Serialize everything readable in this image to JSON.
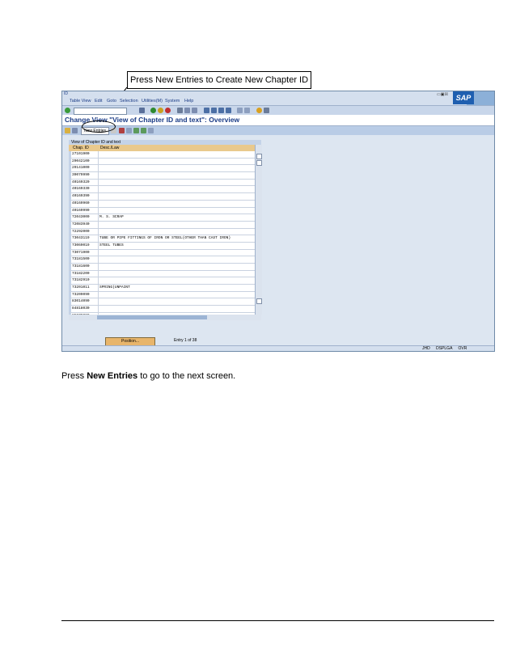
{
  "callout": {
    "text": "Press New Entries to Create New Chapter ID"
  },
  "window": {
    "title_icon": "ID"
  },
  "menu": {
    "items": [
      "Table View",
      "Edit",
      "Goto",
      "Selection",
      "Utilities(M)",
      "System",
      "Help"
    ]
  },
  "screen": {
    "title": "Change View \"View of Chapter ID and text\": Overview"
  },
  "app_toolbar": {
    "new_entries_label": "New Entries"
  },
  "table": {
    "caption": "View of Chapter ID and text",
    "columns": [
      "Chap. ID",
      "Desc./Law"
    ],
    "rows": [
      {
        "id": "27101900",
        "desc": ""
      },
      {
        "id": "29042100",
        "desc": ""
      },
      {
        "id": "29141000",
        "desc": ""
      },
      {
        "id": "39079990",
        "desc": ""
      },
      {
        "id": "40169320",
        "desc": ""
      },
      {
        "id": "40169330",
        "desc": ""
      },
      {
        "id": "40169390",
        "desc": ""
      },
      {
        "id": "40169960",
        "desc": ""
      },
      {
        "id": "40169990",
        "desc": ""
      },
      {
        "id": "72043000",
        "desc": "M. S. SCRAP"
      },
      {
        "id": "72083940",
        "desc": ""
      },
      {
        "id": "72292000",
        "desc": ""
      },
      {
        "id": "73043119",
        "desc": "TUBE OR PIPE FITTINGS OF IRON OR STEEL(OTHER THAN CAST IRON)"
      },
      {
        "id": "73069019",
        "desc": "STEEL TUBES"
      },
      {
        "id": "73071900",
        "desc": ""
      },
      {
        "id": "73181500",
        "desc": ""
      },
      {
        "id": "73181600",
        "desc": ""
      },
      {
        "id": "73182200",
        "desc": ""
      },
      {
        "id": "73182910",
        "desc": ""
      },
      {
        "id": "73201011",
        "desc": "SPRING(UNPAINT"
      },
      {
        "id": "73209090",
        "desc": ""
      },
      {
        "id": "83014090",
        "desc": ""
      },
      {
        "id": "84818030",
        "desc": ""
      },
      {
        "id": "85079090",
        "desc": ""
      }
    ]
  },
  "position": {
    "button_label": "Position...",
    "entry_text": "Entry 1 of 38"
  },
  "statusbar": {
    "fields": [
      "JHD",
      "DSPLGA",
      "OVR"
    ]
  },
  "caption": {
    "prefix": "Press ",
    "bold": "New Entries",
    "suffix": " to go to the next screen."
  },
  "colors": {
    "title_blue": "#1b3c86",
    "header_orange": "#e9c98d",
    "frame": "#dde6f1"
  }
}
